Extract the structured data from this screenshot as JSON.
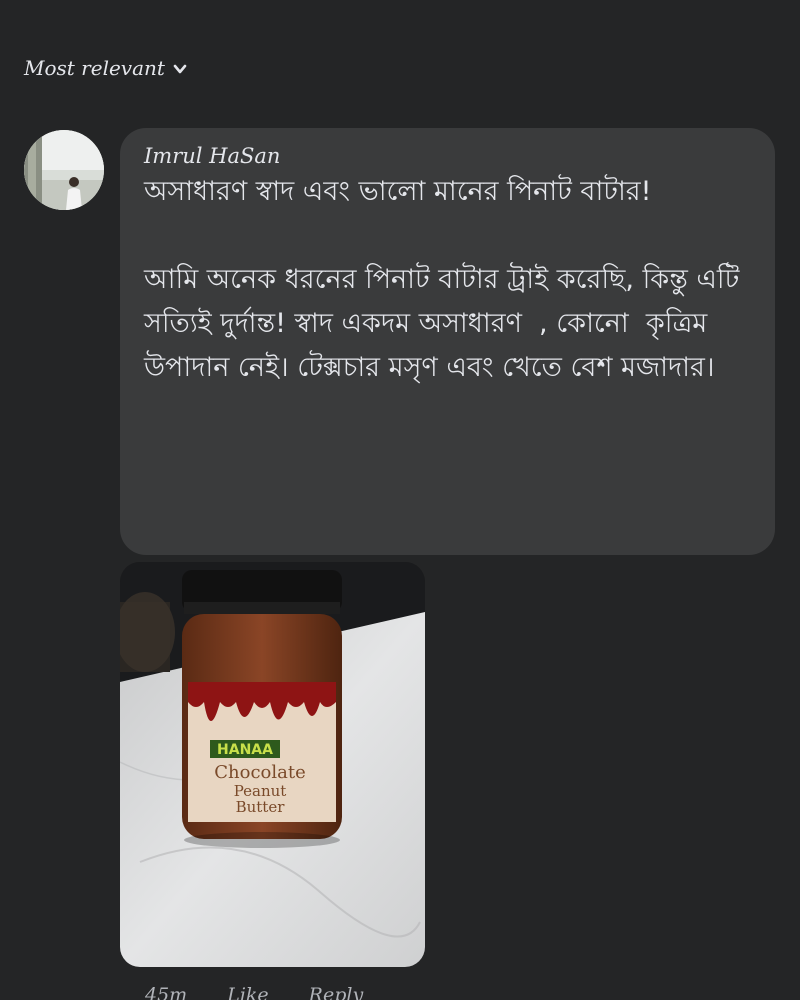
{
  "sort": {
    "label": "Most relevant"
  },
  "comment": {
    "author": "Imrul HaSan",
    "paragraph1": "অসাধারণ স্বাদ এবং ভালো মানের পিনাট বাটার!",
    "paragraph2": "আমি অনেক ধরনের পিনাট বাটার ট্রাই করেছি, কিন্তু এটি সত্যিই দুর্দান্ত! স্বাদ একদম অসাধারণ  , কোনো  কৃত্রিম উপাদান নেই। টেক্সচার মসৃণ এবং খেতে বেশ মজাদার।"
  },
  "photo": {
    "label_brand": "HANAA",
    "label_line1": "Chocolate",
    "label_line2": "Peanut",
    "label_line3": "Butter"
  },
  "actions": {
    "time": "45m",
    "like": "Like",
    "reply": "Reply"
  },
  "colors": {
    "background": "#242526",
    "bubble": "#3a3b3c",
    "text": "#e4e6eb",
    "muted": "#b0b3b8"
  }
}
